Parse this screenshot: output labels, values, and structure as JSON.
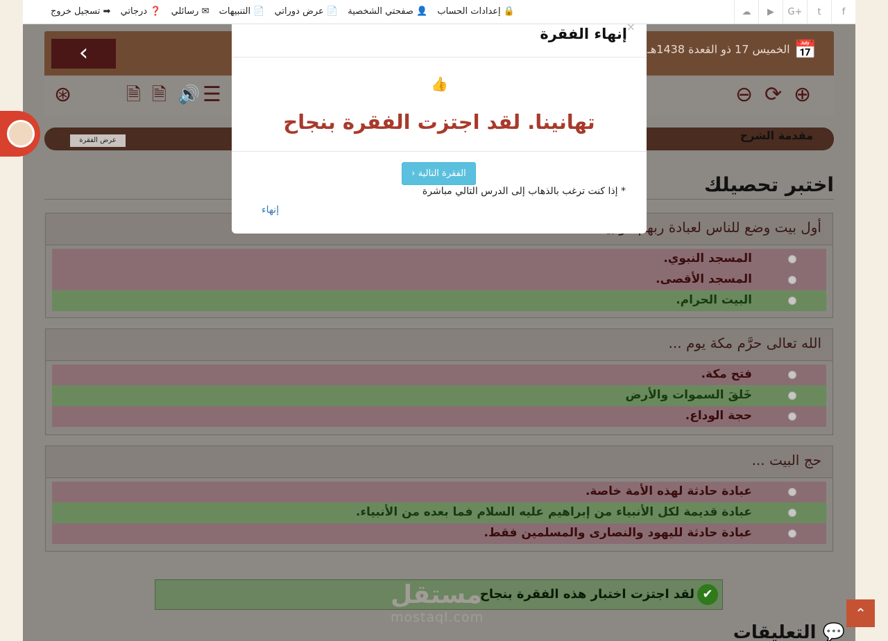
{
  "topbar": {
    "links": [
      {
        "label": "إعدادات الحساب",
        "icon": "lock-icon"
      },
      {
        "label": "صفحتي الشخصية",
        "icon": "user-icon"
      },
      {
        "label": "عرض دوراتي",
        "icon": "file-icon"
      },
      {
        "label": "التنبيهات",
        "icon": "file-icon"
      },
      {
        "label": "رسائلي",
        "icon": "envelope-icon"
      },
      {
        "label": "درجاتي",
        "icon": "question-icon"
      },
      {
        "label": "تسجيل خروج",
        "icon": "sign-out-icon"
      }
    ],
    "social": [
      "facebook-icon",
      "twitter-icon",
      "google-plus-icon",
      "youtube-icon",
      "soundcloud-icon"
    ]
  },
  "header": {
    "date": "الخميس 17 ذو القعدة 1438هـ",
    "back_icon": "chevron-left-icon"
  },
  "lesson_bar": {
    "title": "مقدمة الشرح",
    "view_button": "عرض الفقرة"
  },
  "quiz": {
    "heading": "اختبر تحصيلك",
    "questions": [
      {
        "text": "أول بيت وضع للناس لعبادة ربهم هو بيت الله ...",
        "options": [
          {
            "label": "المسجد النبوي.",
            "state": "wrong"
          },
          {
            "label": "المسجد الأقصى.",
            "state": "wrong"
          },
          {
            "label": "البيت الحرام.",
            "state": "right"
          }
        ]
      },
      {
        "text": "الله تعالى حرَّم مكة يوم ...",
        "options": [
          {
            "label": "فتح مكة.",
            "state": "wrong"
          },
          {
            "label": "خَلقَ السموات والأرض",
            "state": "right"
          },
          {
            "label": "حجة الوداع.",
            "state": "wrong"
          }
        ]
      },
      {
        "text": "حج البيت ...",
        "options": [
          {
            "label": "عبادة حادثة لهذه الأمة خاصة.",
            "state": "wrong"
          },
          {
            "label": "عبادة قديمة لكل الأنبياء من إبراهيم عليه السلام فما بعده من الأنبياء.",
            "state": "right"
          },
          {
            "label": "عبادة حادثة لليهود والنصارى والمسلمين فقط.",
            "state": "wrong"
          }
        ]
      }
    ],
    "result": "لقد اجتزت اختبار هذه الفقرة بنجاح"
  },
  "watermark": {
    "ar": "مستقل",
    "en": "mostaql.com"
  },
  "comments_heading": "التعليقات",
  "modal": {
    "title": "إنهاء الفقرة",
    "close": "×",
    "message": "تهانينا. لقد اجتزت الفقرة بنجاح",
    "next_button": "الفقرة التالية",
    "note": "* إذا كنت ترغب بالذهاب إلى الدرس التالي مباشرة",
    "finish_link": "إنهاء"
  },
  "colors": {
    "accent": "#a83a2b",
    "info": "#5bc0de",
    "success": "#2f7a1a"
  }
}
